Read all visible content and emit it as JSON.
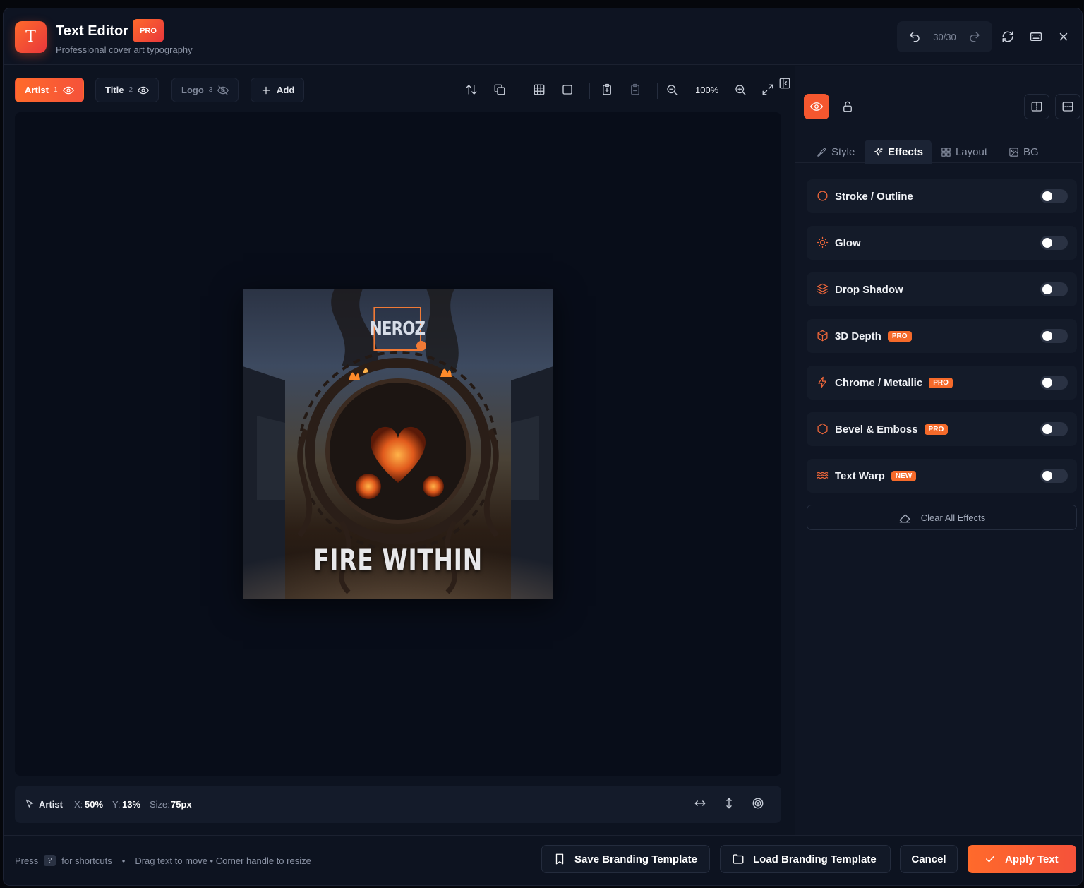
{
  "app": {
    "title": "Text Editor",
    "badge": "PRO",
    "subtitle": "Professional cover art typography",
    "history_count": "30/30"
  },
  "layers": [
    {
      "label": "Artist",
      "num": "1",
      "visible": true,
      "active": true
    },
    {
      "label": "Title",
      "num": "2",
      "visible": true,
      "active": false
    },
    {
      "label": "Logo",
      "num": "3",
      "visible": false,
      "active": false
    }
  ],
  "toolbar": {
    "add_label": "Add",
    "zoom": "100%"
  },
  "artwork": {
    "artist_text": "NEROZ",
    "title_text": "FIRE WITHIN"
  },
  "status": {
    "layer": "Artist",
    "x_label": "X:",
    "x_value": "50%",
    "y_label": "Y:",
    "y_value": "13%",
    "size_label": "Size:",
    "size_value": "75px"
  },
  "panel": {
    "tabs": [
      {
        "label": "Style",
        "icon": "brush-icon"
      },
      {
        "label": "Effects",
        "icon": "sparkles-icon"
      },
      {
        "label": "Layout",
        "icon": "grid-icon"
      },
      {
        "label": "BG",
        "icon": "image-icon"
      }
    ],
    "active_tab": "Effects",
    "effects": [
      {
        "name": "Stroke / Outline",
        "icon": "circle-icon",
        "badge": "",
        "enabled": false
      },
      {
        "name": "Glow",
        "icon": "sun-icon",
        "badge": "",
        "enabled": false
      },
      {
        "name": "Drop Shadow",
        "icon": "layers-icon",
        "badge": "",
        "enabled": false
      },
      {
        "name": "3D Depth",
        "icon": "box-icon",
        "badge": "PRO",
        "enabled": false
      },
      {
        "name": "Chrome / Metallic",
        "icon": "zap-icon",
        "badge": "PRO",
        "enabled": false
      },
      {
        "name": "Bevel & Emboss",
        "icon": "hexagon-icon",
        "badge": "PRO",
        "enabled": false
      },
      {
        "name": "Text Warp",
        "icon": "waves-icon",
        "badge": "NEW",
        "enabled": false
      }
    ],
    "clear_label": "Clear All Effects"
  },
  "footer": {
    "press": "Press",
    "key": "?",
    "shortcuts": "for shortcuts",
    "bullet": "•",
    "hint": "Drag text to move • Corner handle to resize",
    "save_template": "Save Branding Template",
    "load_template": "Load Branding Template",
    "cancel": "Cancel",
    "apply": "Apply Text"
  },
  "colors": {
    "accent": "#f5572f",
    "background": "#0d1320",
    "canvas": "#080d19"
  }
}
